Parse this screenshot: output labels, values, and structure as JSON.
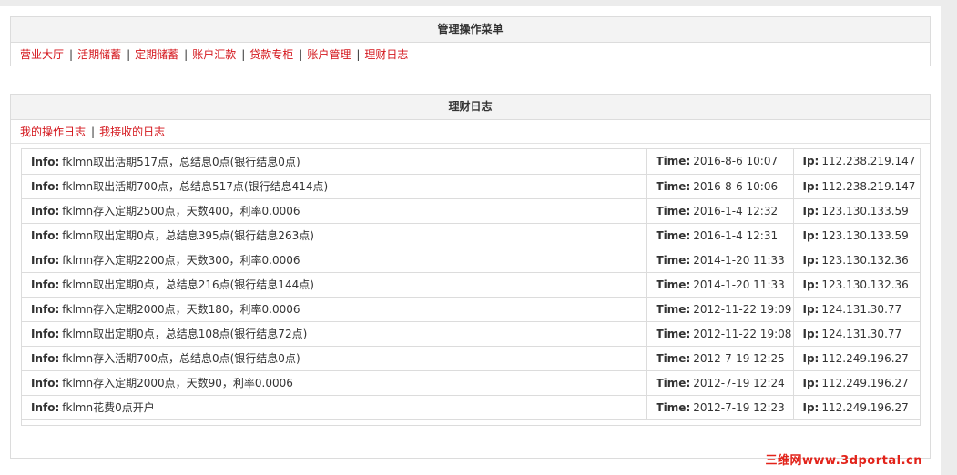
{
  "menu": {
    "title": "管理操作菜单",
    "links": [
      "营业大厅",
      "活期储蓄",
      "定期储蓄",
      "账户汇款",
      "贷款专柜",
      "账户管理",
      "理财日志"
    ]
  },
  "log": {
    "title": "理财日志",
    "tabs": [
      "我的操作日志",
      "我接收的日志"
    ],
    "labels": {
      "info": "Info:",
      "time": "Time:",
      "ip": "Ip:"
    },
    "rows": [
      {
        "info": "fklmn取出活期517点，总结息0点(银行结息0点)",
        "time": "2016-8-6 10:07",
        "ip": "112.238.219.147"
      },
      {
        "info": "fklmn取出活期700点，总结息517点(银行结息414点)",
        "time": "2016-8-6 10:06",
        "ip": "112.238.219.147"
      },
      {
        "info": "fklmn存入定期2500点，天数400，利率0.0006",
        "time": "2016-1-4 12:32",
        "ip": "123.130.133.59"
      },
      {
        "info": "fklmn取出定期0点，总结息395点(银行结息263点)",
        "time": "2016-1-4 12:31",
        "ip": "123.130.133.59"
      },
      {
        "info": "fklmn存入定期2200点，天数300，利率0.0006",
        "time": "2014-1-20 11:33",
        "ip": "123.130.132.36"
      },
      {
        "info": "fklmn取出定期0点，总结息216点(银行结息144点)",
        "time": "2014-1-20 11:33",
        "ip": "123.130.132.36"
      },
      {
        "info": "fklmn存入定期2000点，天数180，利率0.0006",
        "time": "2012-11-22 19:09",
        "ip": "124.131.30.77"
      },
      {
        "info": "fklmn取出定期0点，总结息108点(银行结息72点)",
        "time": "2012-11-22 19:08",
        "ip": "124.131.30.77"
      },
      {
        "info": "fklmn存入活期700点，总结息0点(银行结息0点)",
        "time": "2012-7-19 12:25",
        "ip": "112.249.196.27"
      },
      {
        "info": "fklmn存入定期2000点，天数90，利率0.0006",
        "time": "2012-7-19 12:24",
        "ip": "112.249.196.27"
      },
      {
        "info": "fklmn花费0点开户",
        "time": "2012-7-19 12:23",
        "ip": "112.249.196.27"
      }
    ]
  },
  "watermark": "三维网www.3dportal.cn",
  "colors": {
    "link": "#d4161c",
    "header_bg": "#f3f3f3",
    "border": "#dcdcdc"
  }
}
